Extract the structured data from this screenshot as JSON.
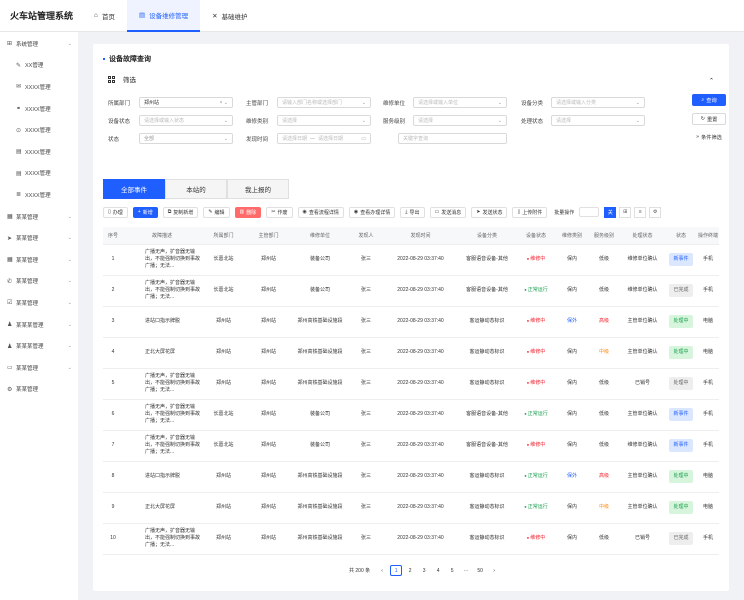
{
  "app": {
    "title": "火车站管理系统"
  },
  "nav": {
    "tabs": [
      {
        "label": "首页",
        "icon": "home-icon"
      },
      {
        "label": "设备维修管理",
        "icon": "device-icon"
      },
      {
        "label": "基础维护",
        "icon": "tools-icon"
      }
    ]
  },
  "sidebar": {
    "items": [
      {
        "label": "系统管理",
        "icon": "grid-icon",
        "sub": false,
        "chev": true
      },
      {
        "label": "XX管理",
        "icon": "edit-icon",
        "sub": true
      },
      {
        "label": "XXXX管理",
        "icon": "mail-icon",
        "sub": true
      },
      {
        "label": "XXXX管理",
        "icon": "link-icon",
        "sub": true
      },
      {
        "label": "XXXX管理",
        "icon": "lock-icon",
        "sub": true
      },
      {
        "label": "XXXX管理",
        "icon": "doc-icon",
        "sub": true
      },
      {
        "label": "XXXX管理",
        "icon": "doc-icon",
        "sub": true
      },
      {
        "label": "XXXX管理",
        "icon": "list-icon",
        "sub": true
      },
      {
        "label": "某某管理",
        "icon": "box-icon",
        "sub": false,
        "chev": true
      },
      {
        "label": "某某管理",
        "icon": "send-icon",
        "sub": false,
        "chev": true
      },
      {
        "label": "某某管理",
        "icon": "box-icon",
        "sub": false,
        "chev": true
      },
      {
        "label": "某某管理",
        "icon": "phone-icon",
        "sub": false,
        "chev": true
      },
      {
        "label": "某某管理",
        "icon": "check-icon",
        "sub": false,
        "chev": true
      },
      {
        "label": "某某某管理",
        "icon": "user-icon",
        "sub": false,
        "chev": true
      },
      {
        "label": "某某某管理",
        "icon": "user-icon",
        "sub": false,
        "chev": true
      },
      {
        "label": "某某管理",
        "icon": "card-icon",
        "sub": false,
        "chev": true
      },
      {
        "label": "某某管理",
        "icon": "gear-icon",
        "sub": false,
        "chev": false
      }
    ]
  },
  "page": {
    "title": "设备故障查询",
    "filter_title": "筛选"
  },
  "filters": {
    "dept_label": "所属部门",
    "dept_value": "郑州站",
    "mdept_label": "主管部门",
    "mdept_ph": "请输入部门名称或选择部门",
    "unit_label": "维修单位",
    "unit_ph": "请选择或输入单位",
    "cat_label": "设备分类",
    "cat_ph": "请选择或输入分类",
    "fault_label": "设备状态",
    "fault_ph": "请选择或输入状态",
    "rtype_label": "维修类别",
    "rtype_ph": "请选择",
    "level_label": "服务级别",
    "level_ph": "请选择",
    "pstate_label": "处理状态",
    "pstate_ph": "请选择",
    "state_label": "状态",
    "state_value": "全部",
    "time_label": "发现时间",
    "start_ph": "请选择日期",
    "sep": "—",
    "end_ph": "请选择日期",
    "kw_ph": "关键字查询"
  },
  "buttons": {
    "search": "查询",
    "reset": "重置",
    "cond": "条件筛选"
  },
  "tabs": [
    "全部事件",
    "本站的",
    "我上报的"
  ],
  "toolbar": [
    {
      "label": "办理",
      "icon": "clipboard-icon",
      "style": ""
    },
    {
      "label": "新增",
      "icon": "plus-icon",
      "style": "blue"
    },
    {
      "label": "复制新增",
      "icon": "copy-icon",
      "style": ""
    },
    {
      "label": "编辑",
      "icon": "pencil-icon",
      "style": ""
    },
    {
      "label": "删除",
      "icon": "trash-icon",
      "style": "red"
    },
    {
      "label": "作废",
      "icon": "scissors-icon",
      "style": ""
    },
    {
      "label": "查看流程详情",
      "icon": "eye-icon",
      "style": ""
    },
    {
      "label": "查看办理详情",
      "icon": "eye-icon",
      "style": ""
    },
    {
      "label": "导出",
      "icon": "download-icon",
      "style": ""
    },
    {
      "label": "发送消息",
      "icon": "message-icon",
      "style": ""
    },
    {
      "label": "发送状态",
      "icon": "send-icon",
      "style": ""
    },
    {
      "label": "上传附件",
      "icon": "file-icon",
      "style": ""
    }
  ],
  "batch_label": "批量操作",
  "view_switch": [
    "关",
    "⊞",
    "≡",
    "⚙"
  ],
  "table": {
    "headers": [
      "序号",
      "故障描述",
      "所属部门",
      "主管部门",
      "维修单位",
      "发现人",
      "发现时间",
      "设备分类",
      "设备状态",
      "维修类别",
      "服务级别",
      "处理状态",
      "状态",
      "操作终端"
    ],
    "rows": [
      {
        "no": "1",
        "desc": "广播无声，扩音器无输出，不能强制切换到事故广播；无法...",
        "dept": "长葛北站",
        "mdept": "郑州站",
        "unit": "装备公司",
        "finder": "张三",
        "time": "2022-08-29 03:37:40",
        "cat": "客服语音设备-其他",
        "status": "维修中",
        "sc": "r",
        "rtype": "保内",
        "rc": "",
        "level": "低级",
        "lc": "",
        "proc": "维修单位确认",
        "state": "新事件",
        "bc": "new",
        "term": "手机"
      },
      {
        "no": "2",
        "desc": "广播无声，扩音器无输出，不能强制切换到事故广播；无法...",
        "dept": "长葛北站",
        "mdept": "郑州站",
        "unit": "装备公司",
        "finder": "张三",
        "time": "2022-08-29 03:37:40",
        "cat": "客服语音设备-其他",
        "status": "正常运行",
        "sc": "g",
        "rtype": "保内",
        "rc": "",
        "level": "低级",
        "lc": "",
        "proc": "维修单位确认",
        "state": "已完成",
        "bc": "done",
        "term": "手机"
      },
      {
        "no": "3",
        "desc": "进站口指示牌脱",
        "dept": "郑州站",
        "mdept": "郑州站",
        "unit": "郑州高铁基础设施段",
        "finder": "张三",
        "time": "2022-08-29 03:37:40",
        "cat": "客运静动态标识",
        "status": "维修中",
        "sc": "r",
        "rtype": "保外",
        "rc": "blue",
        "level": "高级",
        "lc": "red",
        "proc": "主管单位确认",
        "state": "处理中",
        "bc": "proc",
        "term": "电脑"
      },
      {
        "no": "4",
        "desc": "正北大屏花屏",
        "dept": "郑州站",
        "mdept": "郑州站",
        "unit": "郑州高铁基础设施段",
        "finder": "张三",
        "time": "2022-08-29 03:37:40",
        "cat": "客运静动态标识",
        "status": "维修中",
        "sc": "r",
        "rtype": "保内",
        "rc": "",
        "level": "中级",
        "lc": "orange",
        "proc": "主管单位确认",
        "state": "处理中",
        "bc": "proc",
        "term": "电脑"
      },
      {
        "no": "5",
        "desc": "广播无声，扩音器无输出，不能强制切换到事故广播；无法...",
        "dept": "郑州站",
        "mdept": "郑州站",
        "unit": "郑州高铁基础设施段",
        "finder": "张三",
        "time": "2022-08-29 03:37:40",
        "cat": "客运静动态标识",
        "status": "维修中",
        "sc": "r",
        "rtype": "保内",
        "rc": "",
        "level": "低级",
        "lc": "",
        "proc": "已销号",
        "state": "处理中",
        "bc": "done",
        "term": "手机"
      },
      {
        "no": "6",
        "desc": "广播无声，扩音器无输出，不能强制切换到事故广播；无法...",
        "dept": "长葛北站",
        "mdept": "郑州站",
        "unit": "装备公司",
        "finder": "张三",
        "time": "2022-08-29 03:37:40",
        "cat": "客服语音设备-其他",
        "status": "正常运行",
        "sc": "g",
        "rtype": "保内",
        "rc": "",
        "level": "低级",
        "lc": "",
        "proc": "主管单位确认",
        "state": "新事件",
        "bc": "new",
        "term": "手机"
      },
      {
        "no": "7",
        "desc": "广播无声，扩音器无输出，不能强制切换到事故广播；无法...",
        "dept": "长葛北站",
        "mdept": "郑州站",
        "unit": "装备公司",
        "finder": "张三",
        "time": "2022-08-29 03:37:40",
        "cat": "客服语音设备-其他",
        "status": "维修中",
        "sc": "r",
        "rtype": "保内",
        "rc": "",
        "level": "低级",
        "lc": "",
        "proc": "维修单位确认",
        "state": "新事件",
        "bc": "new",
        "term": "手机"
      },
      {
        "no": "8",
        "desc": "进站口指示牌脱",
        "dept": "郑州站",
        "mdept": "郑州站",
        "unit": "郑州高铁基础设施段",
        "finder": "张三",
        "time": "2022-08-29 03:37:40",
        "cat": "客运静动态标识",
        "status": "正常运行",
        "sc": "g",
        "rtype": "保外",
        "rc": "blue",
        "level": "高级",
        "lc": "red",
        "proc": "主管单位确认",
        "state": "处理中",
        "bc": "proc",
        "term": "电脑"
      },
      {
        "no": "9",
        "desc": "正北大屏花屏",
        "dept": "郑州站",
        "mdept": "郑州站",
        "unit": "郑州高铁基础设施段",
        "finder": "张三",
        "time": "2022-08-29 03:37:40",
        "cat": "客运静动态标识",
        "status": "正常运行",
        "sc": "g",
        "rtype": "保内",
        "rc": "",
        "level": "中级",
        "lc": "orange",
        "proc": "主管单位确认",
        "state": "处理中",
        "bc": "proc",
        "term": "电脑"
      },
      {
        "no": "10",
        "desc": "广播无声，扩音器无输出，不能强制切换到事故广播；无法...",
        "dept": "郑州站",
        "mdept": "郑州站",
        "unit": "郑州高铁基础设施段",
        "finder": "张三",
        "time": "2022-08-29 03:37:40",
        "cat": "客运静动态标识",
        "status": "维修中",
        "sc": "r",
        "rtype": "保内",
        "rc": "",
        "level": "低级",
        "lc": "",
        "proc": "已销号",
        "state": "已完成",
        "bc": "done",
        "term": "手机"
      }
    ]
  },
  "pager": {
    "total": "共 200 条",
    "prev": "‹",
    "pages": [
      "1",
      "2",
      "3",
      "4",
      "5",
      "···",
      "50"
    ],
    "next": "›",
    "current": "1"
  }
}
